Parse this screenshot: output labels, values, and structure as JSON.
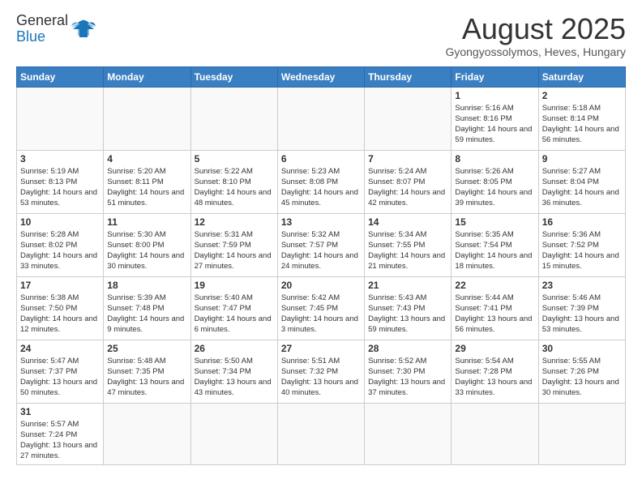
{
  "header": {
    "logo_line1": "General",
    "logo_line2": "Blue",
    "month_year": "August 2025",
    "location": "Gyongyossolymos, Heves, Hungary"
  },
  "weekdays": [
    "Sunday",
    "Monday",
    "Tuesday",
    "Wednesday",
    "Thursday",
    "Friday",
    "Saturday"
  ],
  "weeks": [
    [
      {
        "day": "",
        "info": ""
      },
      {
        "day": "",
        "info": ""
      },
      {
        "day": "",
        "info": ""
      },
      {
        "day": "",
        "info": ""
      },
      {
        "day": "",
        "info": ""
      },
      {
        "day": "1",
        "info": "Sunrise: 5:16 AM\nSunset: 8:16 PM\nDaylight: 14 hours and 59 minutes."
      },
      {
        "day": "2",
        "info": "Sunrise: 5:18 AM\nSunset: 8:14 PM\nDaylight: 14 hours and 56 minutes."
      }
    ],
    [
      {
        "day": "3",
        "info": "Sunrise: 5:19 AM\nSunset: 8:13 PM\nDaylight: 14 hours and 53 minutes."
      },
      {
        "day": "4",
        "info": "Sunrise: 5:20 AM\nSunset: 8:11 PM\nDaylight: 14 hours and 51 minutes."
      },
      {
        "day": "5",
        "info": "Sunrise: 5:22 AM\nSunset: 8:10 PM\nDaylight: 14 hours and 48 minutes."
      },
      {
        "day": "6",
        "info": "Sunrise: 5:23 AM\nSunset: 8:08 PM\nDaylight: 14 hours and 45 minutes."
      },
      {
        "day": "7",
        "info": "Sunrise: 5:24 AM\nSunset: 8:07 PM\nDaylight: 14 hours and 42 minutes."
      },
      {
        "day": "8",
        "info": "Sunrise: 5:26 AM\nSunset: 8:05 PM\nDaylight: 14 hours and 39 minutes."
      },
      {
        "day": "9",
        "info": "Sunrise: 5:27 AM\nSunset: 8:04 PM\nDaylight: 14 hours and 36 minutes."
      }
    ],
    [
      {
        "day": "10",
        "info": "Sunrise: 5:28 AM\nSunset: 8:02 PM\nDaylight: 14 hours and 33 minutes."
      },
      {
        "day": "11",
        "info": "Sunrise: 5:30 AM\nSunset: 8:00 PM\nDaylight: 14 hours and 30 minutes."
      },
      {
        "day": "12",
        "info": "Sunrise: 5:31 AM\nSunset: 7:59 PM\nDaylight: 14 hours and 27 minutes."
      },
      {
        "day": "13",
        "info": "Sunrise: 5:32 AM\nSunset: 7:57 PM\nDaylight: 14 hours and 24 minutes."
      },
      {
        "day": "14",
        "info": "Sunrise: 5:34 AM\nSunset: 7:55 PM\nDaylight: 14 hours and 21 minutes."
      },
      {
        "day": "15",
        "info": "Sunrise: 5:35 AM\nSunset: 7:54 PM\nDaylight: 14 hours and 18 minutes."
      },
      {
        "day": "16",
        "info": "Sunrise: 5:36 AM\nSunset: 7:52 PM\nDaylight: 14 hours and 15 minutes."
      }
    ],
    [
      {
        "day": "17",
        "info": "Sunrise: 5:38 AM\nSunset: 7:50 PM\nDaylight: 14 hours and 12 minutes."
      },
      {
        "day": "18",
        "info": "Sunrise: 5:39 AM\nSunset: 7:48 PM\nDaylight: 14 hours and 9 minutes."
      },
      {
        "day": "19",
        "info": "Sunrise: 5:40 AM\nSunset: 7:47 PM\nDaylight: 14 hours and 6 minutes."
      },
      {
        "day": "20",
        "info": "Sunrise: 5:42 AM\nSunset: 7:45 PM\nDaylight: 14 hours and 3 minutes."
      },
      {
        "day": "21",
        "info": "Sunrise: 5:43 AM\nSunset: 7:43 PM\nDaylight: 13 hours and 59 minutes."
      },
      {
        "day": "22",
        "info": "Sunrise: 5:44 AM\nSunset: 7:41 PM\nDaylight: 13 hours and 56 minutes."
      },
      {
        "day": "23",
        "info": "Sunrise: 5:46 AM\nSunset: 7:39 PM\nDaylight: 13 hours and 53 minutes."
      }
    ],
    [
      {
        "day": "24",
        "info": "Sunrise: 5:47 AM\nSunset: 7:37 PM\nDaylight: 13 hours and 50 minutes."
      },
      {
        "day": "25",
        "info": "Sunrise: 5:48 AM\nSunset: 7:35 PM\nDaylight: 13 hours and 47 minutes."
      },
      {
        "day": "26",
        "info": "Sunrise: 5:50 AM\nSunset: 7:34 PM\nDaylight: 13 hours and 43 minutes."
      },
      {
        "day": "27",
        "info": "Sunrise: 5:51 AM\nSunset: 7:32 PM\nDaylight: 13 hours and 40 minutes."
      },
      {
        "day": "28",
        "info": "Sunrise: 5:52 AM\nSunset: 7:30 PM\nDaylight: 13 hours and 37 minutes."
      },
      {
        "day": "29",
        "info": "Sunrise: 5:54 AM\nSunset: 7:28 PM\nDaylight: 13 hours and 33 minutes."
      },
      {
        "day": "30",
        "info": "Sunrise: 5:55 AM\nSunset: 7:26 PM\nDaylight: 13 hours and 30 minutes."
      }
    ],
    [
      {
        "day": "31",
        "info": "Sunrise: 5:57 AM\nSunset: 7:24 PM\nDaylight: 13 hours and 27 minutes."
      },
      {
        "day": "",
        "info": ""
      },
      {
        "day": "",
        "info": ""
      },
      {
        "day": "",
        "info": ""
      },
      {
        "day": "",
        "info": ""
      },
      {
        "day": "",
        "info": ""
      },
      {
        "day": "",
        "info": ""
      }
    ]
  ]
}
